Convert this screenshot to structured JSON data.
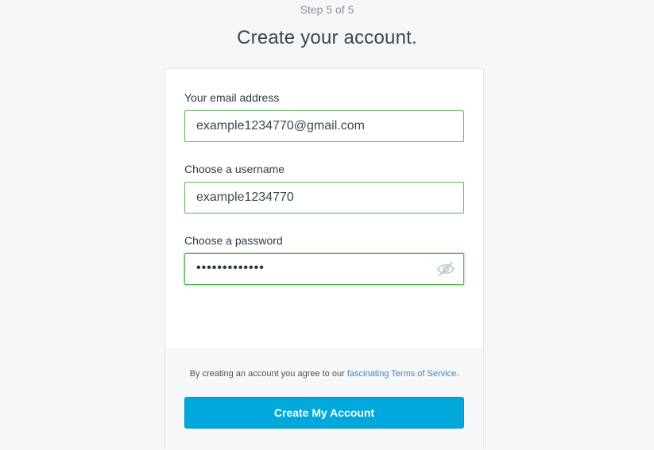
{
  "header": {
    "step": "Step 5 of 5",
    "title": "Create your account."
  },
  "form": {
    "email": {
      "label": "Your email address",
      "value": "example1234770@gmail.com"
    },
    "username": {
      "label": "Choose a username",
      "value": "example1234770"
    },
    "password": {
      "label": "Choose a password",
      "masked_value": "•••••••••••••",
      "toggle_icon": "eye-slash-icon"
    }
  },
  "footer": {
    "terms_prefix": "By creating an account you agree to our ",
    "terms_link_1": "fascinating",
    "terms_space": " ",
    "terms_link_2": "Terms of Service",
    "terms_suffix": ".",
    "submit_label": "Create My Account"
  },
  "colors": {
    "accent": "#00a8dc",
    "field_border_valid": "#5cb85c",
    "link": "#3d86c6"
  }
}
